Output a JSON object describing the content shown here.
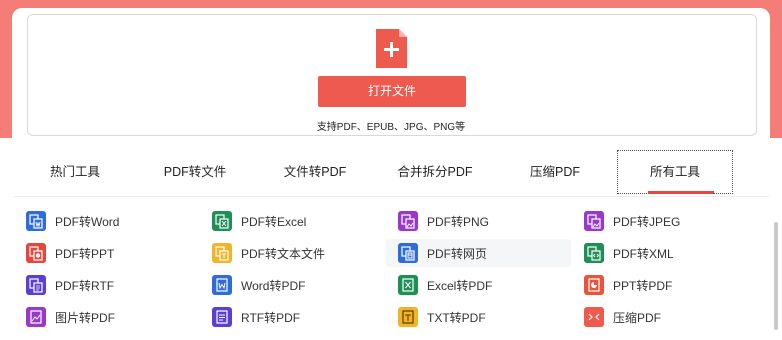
{
  "upload": {
    "open_button_label": "打开文件",
    "support_text": "支持PDF、EPUB、JPG、PNG等",
    "icon": "file-plus-icon"
  },
  "tabs": [
    {
      "label": "热门工具"
    },
    {
      "label": "PDF转文件"
    },
    {
      "label": "文件转PDF"
    },
    {
      "label": "合并拆分PDF"
    },
    {
      "label": "压缩PDF"
    },
    {
      "label": "所有工具",
      "active": true
    }
  ],
  "tools": [
    {
      "label": "PDF转Word",
      "icon": "pdf-to-word-icon",
      "color": "#2f6bd9"
    },
    {
      "label": "PDF转Excel",
      "icon": "pdf-to-excel-icon",
      "color": "#1e8f55"
    },
    {
      "label": "PDF转PNG",
      "icon": "pdf-to-png-icon",
      "color": "#9a39c9"
    },
    {
      "label": "PDF转JPEG",
      "icon": "pdf-to-jpeg-icon",
      "color": "#9a39c9"
    },
    {
      "label": "PDF转PPT",
      "icon": "pdf-to-ppt-icon",
      "color": "#e2483c"
    },
    {
      "label": "PDF转文本文件",
      "icon": "pdf-to-text-icon",
      "color": "#f0b429"
    },
    {
      "label": "PDF转网页",
      "icon": "pdf-to-html-icon",
      "color": "#2f6bd9"
    },
    {
      "label": "PDF转XML",
      "icon": "pdf-to-xml-icon",
      "color": "#1e8f55"
    },
    {
      "label": "PDF转RTF",
      "icon": "pdf-to-rtf-icon",
      "color": "#5a3fd1"
    },
    {
      "label": "Word转PDF",
      "icon": "word-to-pdf-icon",
      "color": "#2f6bd9"
    },
    {
      "label": "Excel转PDF",
      "icon": "excel-to-pdf-icon",
      "color": "#1e8f55"
    },
    {
      "label": "PPT转PDF",
      "icon": "ppt-to-pdf-icon",
      "color": "#e8553a"
    },
    {
      "label": "图片转PDF",
      "icon": "image-to-pdf-icon",
      "color": "#9a39c9"
    },
    {
      "label": "RTF转PDF",
      "icon": "rtf-to-pdf-icon",
      "color": "#5a3fd1"
    },
    {
      "label": "TXT转PDF",
      "icon": "txt-to-pdf-icon",
      "color": "#f0b429"
    },
    {
      "label": "压缩PDF",
      "icon": "compress-pdf-icon",
      "color": "#ef5a4f"
    }
  ],
  "colors": {
    "accent": "#ef5a4f",
    "header_band": "#f57d78"
  }
}
